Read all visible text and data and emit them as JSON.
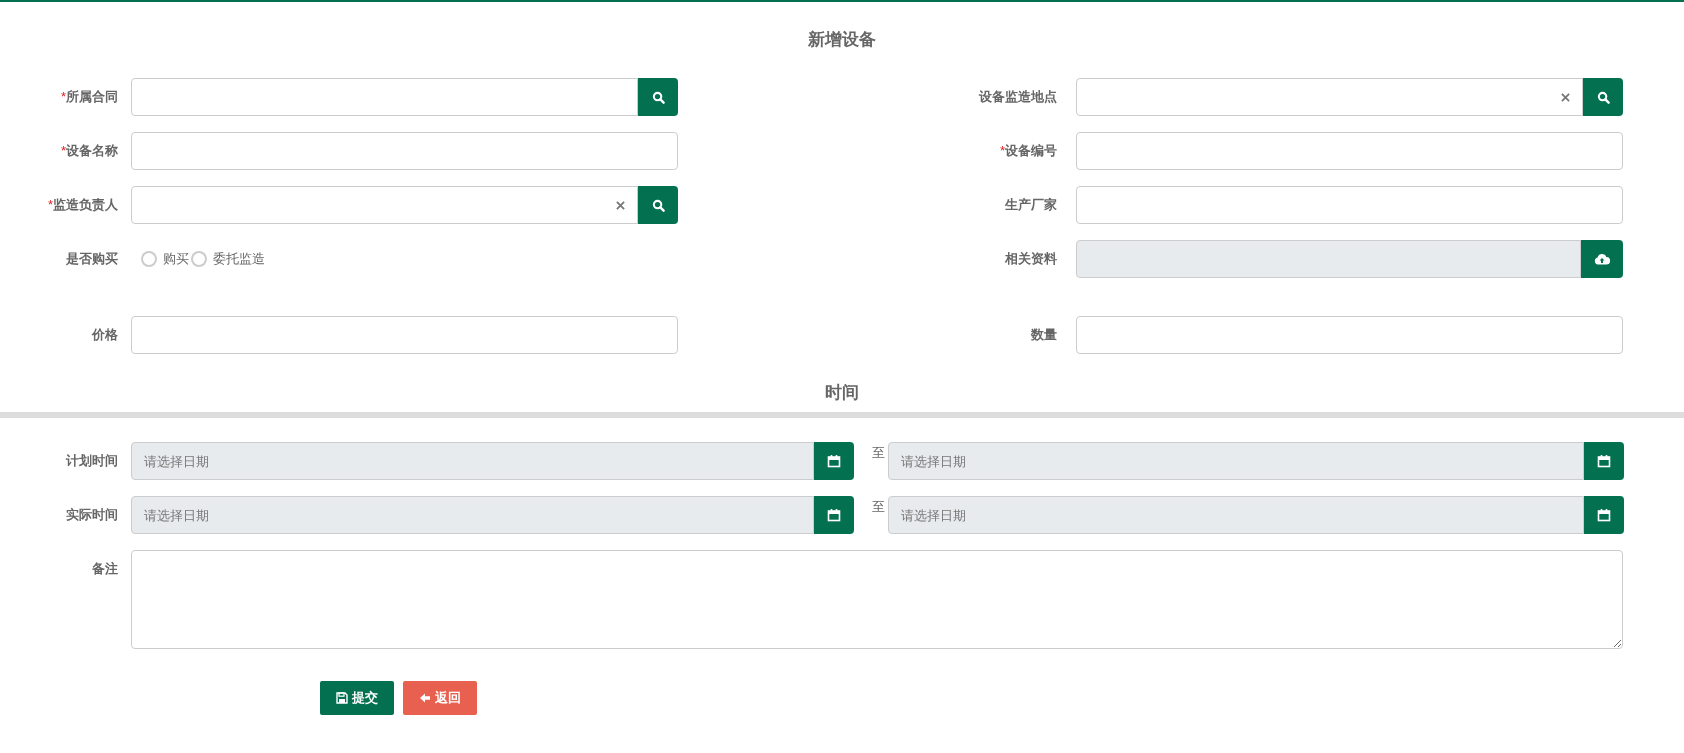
{
  "title": "新增设备",
  "fields": [
    {
      "mark": "*",
      "label": "所属合同",
      "kind": "search"
    },
    {
      "label": "设备监造地点",
      "kind": "search-clear"
    },
    {
      "mark": "*",
      "label": "设备名称",
      "kind": "text"
    },
    {
      "mark": "*",
      "label": "设备编号",
      "kind": "text"
    },
    {
      "mark": "*",
      "label": "监造负责人",
      "kind": "search-clear"
    },
    {
      "label": "生产厂家",
      "kind": "text"
    },
    {
      "label": "是否购买",
      "kind": "radio",
      "options": [
        {
          "label": "购买",
          "selected": false
        },
        {
          "label": "委托监造",
          "selected": false
        }
      ]
    },
    {
      "label": "相关资料",
      "kind": "upload"
    },
    {
      "label": "价格",
      "kind": "text"
    },
    {
      "label": "数量",
      "kind": "text"
    }
  ],
  "time_section": {
    "title": "时间",
    "rows": [
      {
        "label": "计划时间",
        "start": {
          "placeholder": "请选择日期"
        },
        "separator": "至",
        "end": {
          "placeholder": "请选择日期"
        }
      },
      {
        "label": "实际时间",
        "start": {
          "placeholder": "请选择日期"
        },
        "separator": "至",
        "end": {
          "placeholder": "请选择日期"
        }
      }
    ]
  },
  "remarks": {
    "label": "备注"
  },
  "buttons": [
    {
      "label": "提交",
      "kind": "submit"
    },
    {
      "label": "返回",
      "kind": "back"
    }
  ]
}
